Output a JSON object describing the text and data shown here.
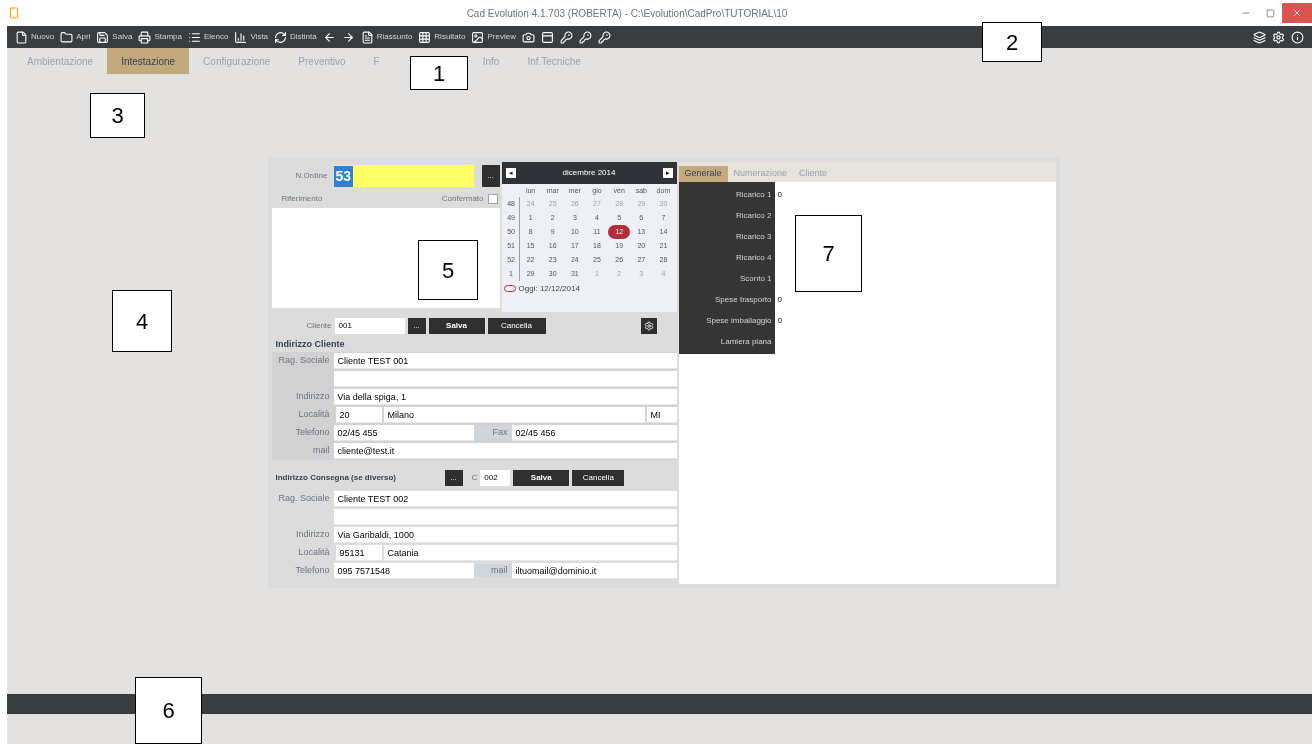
{
  "window": {
    "title": "Cad Evolution 4.1.703 (ROBERTA) - C:\\Evolution\\CadPro\\TUTORIAL\\10"
  },
  "toolbar": {
    "buttons": [
      {
        "kind": "file",
        "label": "Nuovo"
      },
      {
        "kind": "folder",
        "label": "Apri"
      },
      {
        "kind": "save",
        "label": "Salva"
      },
      {
        "kind": "print",
        "label": "Stampa"
      },
      {
        "kind": "list",
        "label": "Elenco"
      },
      {
        "kind": "chart",
        "label": "Vista"
      },
      {
        "kind": "refresh",
        "label": "Distinta"
      },
      {
        "kind": "back"
      },
      {
        "kind": "forward"
      },
      {
        "kind": "doc",
        "label": "Riassunto"
      },
      {
        "kind": "grid",
        "label": "Risultato"
      },
      {
        "kind": "image",
        "label": "Preview"
      },
      {
        "kind": "camera"
      },
      {
        "kind": "panel"
      },
      {
        "kind": "key"
      },
      {
        "kind": "key"
      },
      {
        "kind": "key"
      }
    ],
    "right": [
      {
        "kind": "layers"
      },
      {
        "kind": "gear"
      },
      {
        "kind": "info"
      }
    ]
  },
  "tabs": [
    {
      "label": "Ambientazione",
      "selected": false
    },
    {
      "label": "Intestazione",
      "selected": true
    },
    {
      "label": "Configurazione",
      "selected": false
    },
    {
      "label": "Preventivo",
      "selected": false
    },
    {
      "label": "F",
      "selected": false
    },
    {
      "label": "Info",
      "selected": false
    },
    {
      "label": "Inf.Tecniche",
      "selected": false
    }
  ],
  "order": {
    "label": "N.Ordine",
    "number": "53",
    "browse": "...",
    "reference_label": "Riferimento",
    "confirmed": {
      "label": "Confermato",
      "checked": false
    }
  },
  "calendar": {
    "month": "dicembre 2014",
    "prev": "◂",
    "next": "▸",
    "weekdays": [
      "lun",
      "mar",
      "mer",
      "gio",
      "ven",
      "sab",
      "dom"
    ],
    "weeks": [
      {
        "number": "48",
        "days": [
          {
            "day": "24",
            "muted": true,
            "selected": false
          },
          {
            "day": "25",
            "muted": true,
            "selected": false
          },
          {
            "day": "26",
            "muted": true,
            "selected": false
          },
          {
            "day": "27",
            "muted": true,
            "selected": false
          },
          {
            "day": "28",
            "muted": true,
            "selected": false
          },
          {
            "day": "29",
            "muted": true,
            "selected": false
          },
          {
            "day": "30",
            "muted": true,
            "selected": false
          }
        ]
      },
      {
        "number": "49",
        "days": [
          {
            "day": "1",
            "muted": false,
            "selected": false
          },
          {
            "day": "2",
            "muted": false,
            "selected": false
          },
          {
            "day": "3",
            "muted": false,
            "selected": false
          },
          {
            "day": "4",
            "muted": false,
            "selected": false
          },
          {
            "day": "5",
            "muted": false,
            "selected": false
          },
          {
            "day": "6",
            "muted": false,
            "selected": false
          },
          {
            "day": "7",
            "muted": false,
            "selected": false
          }
        ]
      },
      {
        "number": "50",
        "days": [
          {
            "day": "8",
            "muted": false,
            "selected": false
          },
          {
            "day": "9",
            "muted": false,
            "selected": false
          },
          {
            "day": "10",
            "muted": false,
            "selected": false
          },
          {
            "day": "11",
            "muted": false,
            "selected": false
          },
          {
            "day": "12",
            "muted": false,
            "selected": true
          },
          {
            "day": "13",
            "muted": false,
            "selected": false
          },
          {
            "day": "14",
            "muted": false,
            "selected": false
          }
        ]
      },
      {
        "number": "51",
        "days": [
          {
            "day": "15",
            "muted": false,
            "selected": false
          },
          {
            "day": "16",
            "muted": false,
            "selected": false
          },
          {
            "day": "17",
            "muted": false,
            "selected": false
          },
          {
            "day": "18",
            "muted": false,
            "selected": false
          },
          {
            "day": "19",
            "muted": false,
            "selected": false
          },
          {
            "day": "20",
            "muted": false,
            "selected": false
          },
          {
            "day": "21",
            "muted": false,
            "selected": false
          }
        ]
      },
      {
        "number": "52",
        "days": [
          {
            "day": "22",
            "muted": false,
            "selected": false
          },
          {
            "day": "23",
            "muted": false,
            "selected": false
          },
          {
            "day": "24",
            "muted": false,
            "selected": false
          },
          {
            "day": "25",
            "muted": false,
            "selected": false
          },
          {
            "day": "26",
            "muted": false,
            "selected": false
          },
          {
            "day": "27",
            "muted": false,
            "selected": false
          },
          {
            "day": "28",
            "muted": false,
            "selected": false
          }
        ]
      },
      {
        "number": "1",
        "days": [
          {
            "day": "29",
            "muted": false,
            "selected": false
          },
          {
            "day": "30",
            "muted": false,
            "selected": false
          },
          {
            "day": "31",
            "muted": false,
            "selected": false
          },
          {
            "day": "1",
            "muted": true,
            "selected": false
          },
          {
            "day": "2",
            "muted": true,
            "selected": false
          },
          {
            "day": "3",
            "muted": true,
            "selected": false
          },
          {
            "day": "4",
            "muted": true,
            "selected": false
          }
        ]
      }
    ],
    "today": "Oggi: 12/12/2014"
  },
  "customer": {
    "label": "Cliente",
    "code": "001",
    "browse": "...",
    "save": "Salva",
    "cancel": "Cancella"
  },
  "customer_address": {
    "title": "Indirizzo Cliente",
    "rows": [
      {
        "kind": "single",
        "label": "Rag. Sociale",
        "value": "Cliente TEST 001"
      },
      {
        "kind": "blank"
      },
      {
        "kind": "single",
        "label": "Indirizzo",
        "value": "Via della spiga, 1"
      },
      {
        "kind": "locality",
        "label": "Località",
        "cap": "20",
        "city": "Milano",
        "prov": "MI"
      },
      {
        "kind": "pair",
        "label": "Telefono",
        "value": "02/45 455",
        "label2": "Fax",
        "value2": "02/45 456"
      },
      {
        "kind": "single",
        "label": "mail",
        "value": "cliente@test.it"
      }
    ]
  },
  "delivery": {
    "title": "Indirizzo Consegna (se diverso)",
    "browse": "...",
    "code_label": "C",
    "code": "002",
    "save": "Salva",
    "cancel": "Cancella"
  },
  "delivery_address": {
    "rows": [
      {
        "kind": "single",
        "label": "Rag. Sociale",
        "value": "Cliente TEST 002"
      },
      {
        "kind": "blank"
      },
      {
        "kind": "single",
        "label": "Indirizzo",
        "value": "Via Garibaldi, 1000"
      },
      {
        "kind": "locality",
        "label": "Località",
        "cap": "95131",
        "city": "Catania"
      },
      {
        "kind": "pair",
        "label": "Telefono",
        "value": "095 7571548",
        "label2": "mail",
        "value2": "iltuomail@dominio.it"
      }
    ]
  },
  "right_panel": {
    "tabs": [
      {
        "label": "Generale",
        "selected": true
      },
      {
        "label": "Numerazione",
        "selected": false
      },
      {
        "label": "Cliente",
        "selected": false
      }
    ],
    "rows": [
      {
        "label": "Ricarico 1",
        "value": "0"
      },
      {
        "label": "Ricarico 2"
      },
      {
        "label": "Ricarico 3"
      },
      {
        "label": "Ricarico 4"
      },
      {
        "label": "Sconto 1"
      },
      {
        "label": "Spese trasporto",
        "value": "0"
      },
      {
        "label": "Spese imballaggio",
        "value": "0"
      },
      {
        "label": "Lamiera piana"
      }
    ]
  },
  "callouts": [
    "1",
    "2",
    "3",
    "4",
    "5",
    "6",
    "7"
  ]
}
